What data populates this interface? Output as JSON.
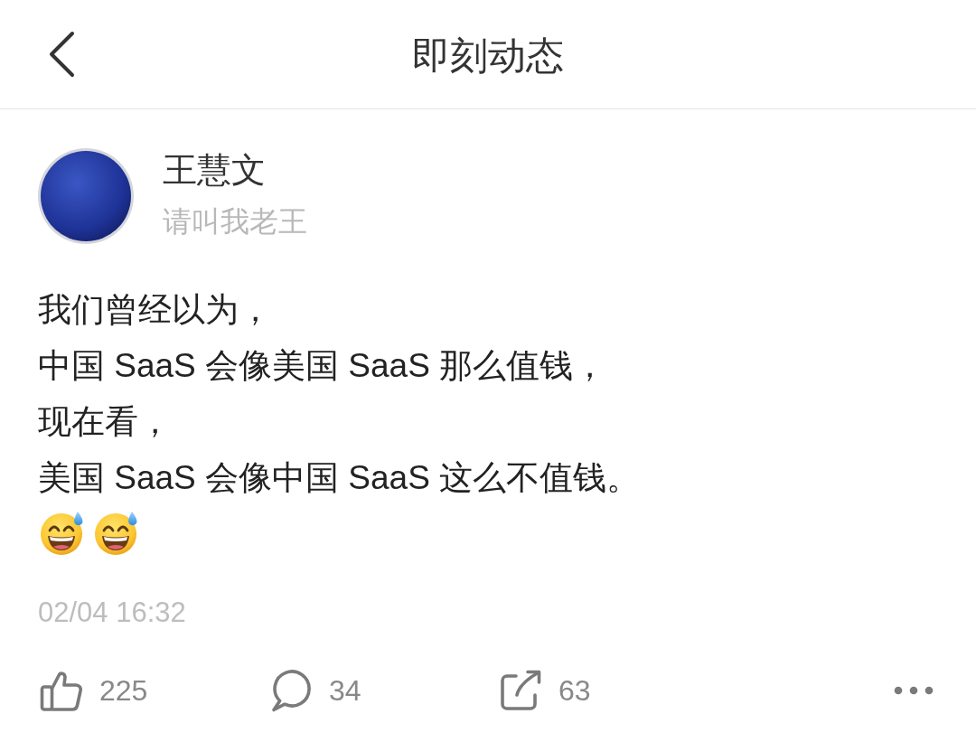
{
  "header": {
    "title": "即刻动态"
  },
  "post": {
    "author": {
      "name": "王慧文",
      "handle": "请叫我老王"
    },
    "lines": [
      "我们曾经以为，",
      "中国 SaaS 会像美国 SaaS 那么值钱，",
      "现在看，",
      "美国 SaaS 会像中国 SaaS 这么不值钱。"
    ],
    "emojis": [
      {
        "kind": "sweat-smile"
      },
      {
        "kind": "sweat-smile"
      }
    ],
    "time": "02/04 16:32",
    "actions": [
      {
        "kind": "like",
        "count": "225"
      },
      {
        "kind": "comment",
        "count": "34"
      },
      {
        "kind": "share",
        "count": "63"
      },
      {
        "kind": "more"
      }
    ]
  }
}
